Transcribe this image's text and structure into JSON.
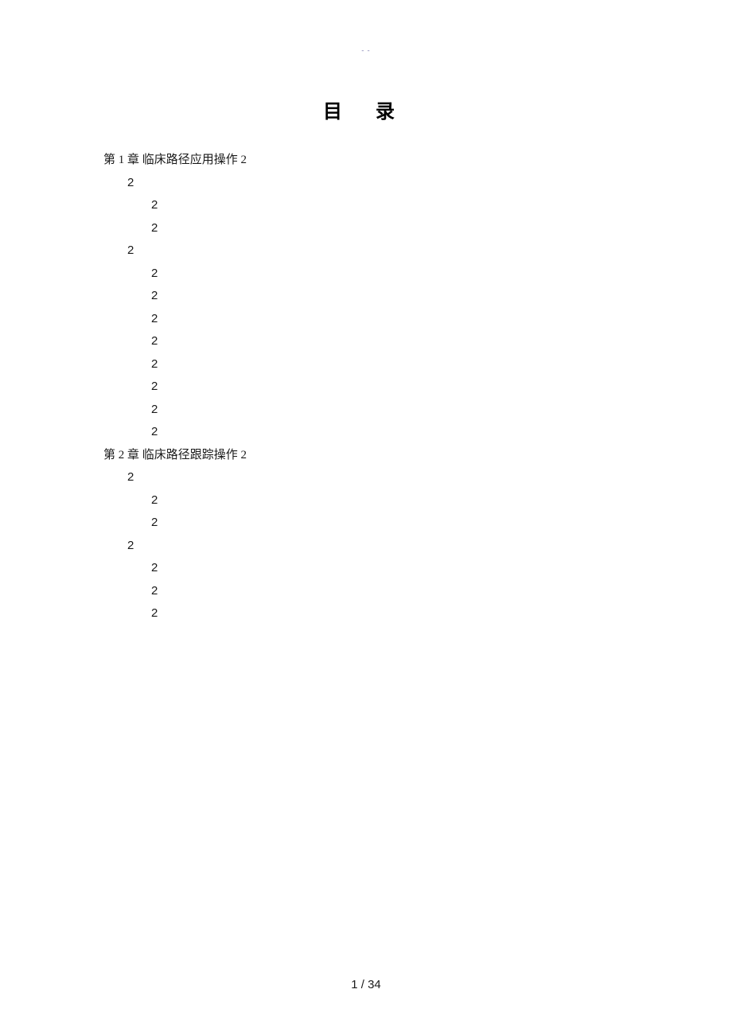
{
  "header_mark": "- -",
  "title": "目  录",
  "toc": {
    "chapter1": {
      "label": "第 1 章 临床路径应用操作 2",
      "l1_a": "2",
      "l2_a1": "2",
      "l2_a2": "2",
      "l1_b": "2",
      "l2_b1": "2",
      "l2_b2": "2",
      "l2_b3": "2",
      "l2_b4": "2",
      "l2_b5": "2",
      "l2_b6": "2",
      "l2_b7": "2",
      "l2_b8": "2"
    },
    "chapter2": {
      "label": "第 2 章 临床路径跟踪操作 2",
      "l1_a": "2",
      "l2_a1": "2",
      "l2_a2": "2",
      "l1_b": "2",
      "l2_b1": "2",
      "l2_b2": "2",
      "l2_b3": "2"
    }
  },
  "page_number": "1  /  34"
}
